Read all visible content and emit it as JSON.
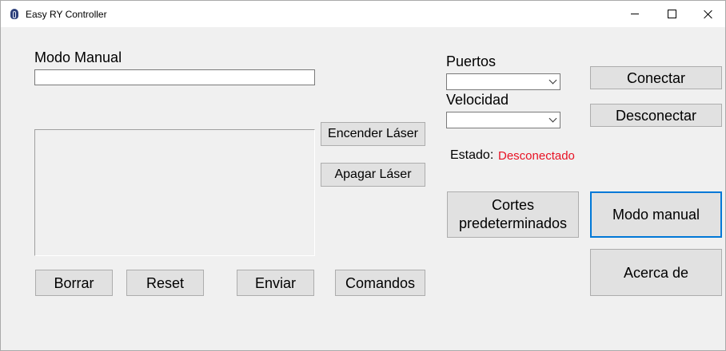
{
  "window": {
    "title": "Easy RY Controller",
    "icon": "app-icon"
  },
  "manual": {
    "label": "Modo Manual",
    "input_value": ""
  },
  "buttons": {
    "encender": "Encender Láser",
    "apagar": "Apagar Láser",
    "borrar": "Borrar",
    "reset": "Reset",
    "enviar": "Enviar",
    "comandos": "Comandos",
    "conectar": "Conectar",
    "desconectar": "Desconectar",
    "cortes": "Cortes predeterminados",
    "modo_manual": "Modo manual",
    "acerca": "Acerca de"
  },
  "connection": {
    "puertos_label": "Puertos",
    "puertos_value": "",
    "velocidad_label": "Velocidad",
    "velocidad_value": "",
    "estado_label": "Estado:",
    "estado_value": "Desconectado",
    "estado_color": "#e81123"
  },
  "colors": {
    "focus_border": "#0078d7"
  }
}
